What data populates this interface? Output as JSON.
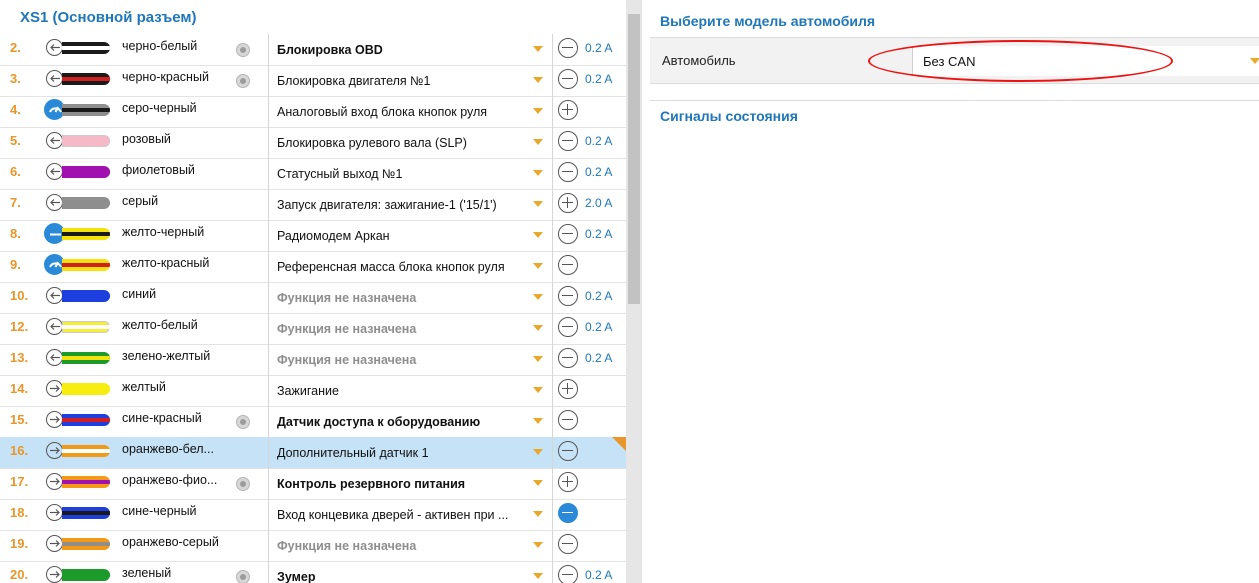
{
  "connector": {
    "title": "XS1 (Основной разъем)"
  },
  "rows": [
    {
      "num": "2.",
      "wire": "черно-белый",
      "gear": true,
      "func": "Блокировка OBD",
      "style": "bold",
      "sign": "minus",
      "amp": "0.2 A",
      "dir": "out",
      "c1": "#1a1a1a",
      "c2": "#ffffff"
    },
    {
      "num": "3.",
      "wire": "черно-красный",
      "gear": true,
      "func": "Блокировка двигателя №1",
      "style": "normal",
      "sign": "minus",
      "amp": "0.2 A",
      "dir": "out",
      "c1": "#1a1a1a",
      "c2": "#d21f1f"
    },
    {
      "num": "4.",
      "wire": "серо-черный",
      "gear": false,
      "func": "Аналоговый вход блока кнопок руля",
      "style": "normal",
      "sign": "plus",
      "amp": "",
      "dir": "analog",
      "c1": "#8e8e8e",
      "c2": "#1a1a1a"
    },
    {
      "num": "5.",
      "wire": "розовый",
      "gear": false,
      "func": "Блокировка рулевого вала (SLP)",
      "style": "normal",
      "sign": "minus",
      "amp": "0.2 A",
      "dir": "out",
      "c1": "#f6b9c8",
      "c2": "#f6b9c8"
    },
    {
      "num": "6.",
      "wire": "фиолетовый",
      "gear": false,
      "func": "Статусный выход №1",
      "style": "normal",
      "sign": "minus",
      "amp": "0.2 A",
      "dir": "out",
      "c1": "#a011b0",
      "c2": "#a011b0"
    },
    {
      "num": "7.",
      "wire": "серый",
      "gear": false,
      "func": "Запуск двигателя: зажигание-1 ('15/1')",
      "style": "normal",
      "sign": "plus",
      "amp": "2.0 A",
      "dir": "out",
      "c1": "#8e8e8e",
      "c2": "#8e8e8e"
    },
    {
      "num": "8.",
      "wire": "желто-черный",
      "gear": false,
      "func": "Радиомодем Аркан",
      "style": "normal",
      "sign": "minus",
      "amp": "0.2 A",
      "dir": "bus",
      "c1": "#f5e20a",
      "c2": "#1a1a1a"
    },
    {
      "num": "9.",
      "wire": "желто-красный",
      "gear": false,
      "func": "Референсная масса блока кнопок руля",
      "style": "normal",
      "sign": "minus",
      "amp": "",
      "dir": "analog",
      "c1": "#f5e20a",
      "c2": "#d21f1f"
    },
    {
      "num": "10.",
      "wire": "синий",
      "gear": false,
      "func": "Функция не назначена",
      "style": "gray",
      "sign": "minus",
      "amp": "0.2 A",
      "dir": "out",
      "c1": "#1e3fe0",
      "c2": "#1e3fe0"
    },
    {
      "num": "12.",
      "wire": "желто-белый",
      "gear": false,
      "func": "Функция не назначена",
      "style": "gray",
      "sign": "minus",
      "amp": "0.2 A",
      "dir": "out",
      "c1": "#f5ee35",
      "c2": "#ffffff"
    },
    {
      "num": "13.",
      "wire": "зелено-желтый",
      "gear": false,
      "func": "Функция не назначена",
      "style": "gray",
      "sign": "minus",
      "amp": "0.2 A",
      "dir": "out",
      "c1": "#1c9a2a",
      "c2": "#f5e20a"
    },
    {
      "num": "14.",
      "wire": "желтый",
      "gear": false,
      "func": "Зажигание",
      "style": "normal",
      "sign": "plus",
      "amp": "",
      "dir": "in",
      "c1": "#f5ee10",
      "c2": "#f5ee10"
    },
    {
      "num": "15.",
      "wire": "сине-красный",
      "gear": true,
      "func": "Датчик доступа к оборудованию",
      "style": "bold",
      "sign": "minus",
      "amp": "",
      "dir": "in",
      "c1": "#1e3fe0",
      "c2": "#d21f1f"
    },
    {
      "num": "16.",
      "wire": "оранжево-бел...",
      "gear": false,
      "func": "Дополнительный датчик 1",
      "style": "normal",
      "sign": "minus",
      "amp": "",
      "dir": "in",
      "c1": "#f29a16",
      "c2": "#ffffff",
      "selected": true
    },
    {
      "num": "17.",
      "wire": "оранжево-фио...",
      "gear": true,
      "func": "Контроль резервного питания",
      "style": "bold",
      "sign": "plus",
      "amp": "",
      "dir": "in",
      "c1": "#f29a16",
      "c2": "#a011b0"
    },
    {
      "num": "18.",
      "wire": "сине-черный",
      "gear": false,
      "func": "Вход концевика дверей - активен при ...",
      "style": "normal",
      "sign": "minus-blue",
      "amp": "",
      "dir": "in",
      "c1": "#1e3fe0",
      "c2": "#1a1a1a"
    },
    {
      "num": "19.",
      "wire": "оранжево-серый",
      "gear": false,
      "func": "Функция не назначена",
      "style": "gray",
      "sign": "minus",
      "amp": "",
      "dir": "in",
      "c1": "#f29a16",
      "c2": "#8e8e8e"
    },
    {
      "num": "20.",
      "wire": "зеленый",
      "gear": true,
      "func": "Зумер",
      "style": "bold",
      "sign": "minus",
      "amp": "0.2 A",
      "dir": "in",
      "c1": "#1c9a2a",
      "c2": "#1c9a2a"
    }
  ],
  "car": {
    "title": "Выберите модель автомобиля",
    "label": "Автомобиль",
    "value": "Без CAN"
  },
  "signals": {
    "title": "Сигналы состояния"
  }
}
